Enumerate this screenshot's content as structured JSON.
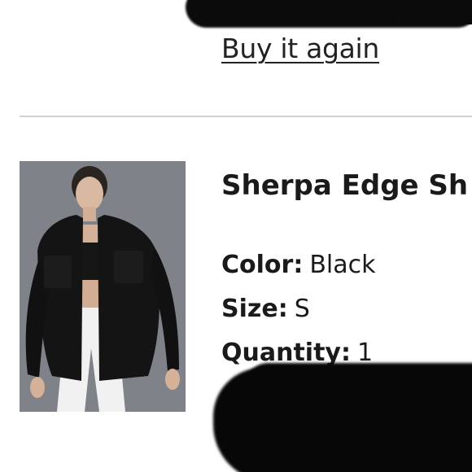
{
  "order_item": {
    "buy_again_label": "Buy it again",
    "product_title": "Sherpa Edge Sh",
    "attributes": {
      "color_label": "Color:",
      "color_value": "Black",
      "size_label": "Size:",
      "size_value": "S",
      "quantity_label": "Quantity:",
      "quantity_value": "1"
    }
  },
  "colors": {
    "image_background": "#7f8289",
    "jacket": "#141414",
    "pants": "#f2f2f2",
    "divider": "#d0d0d0"
  }
}
